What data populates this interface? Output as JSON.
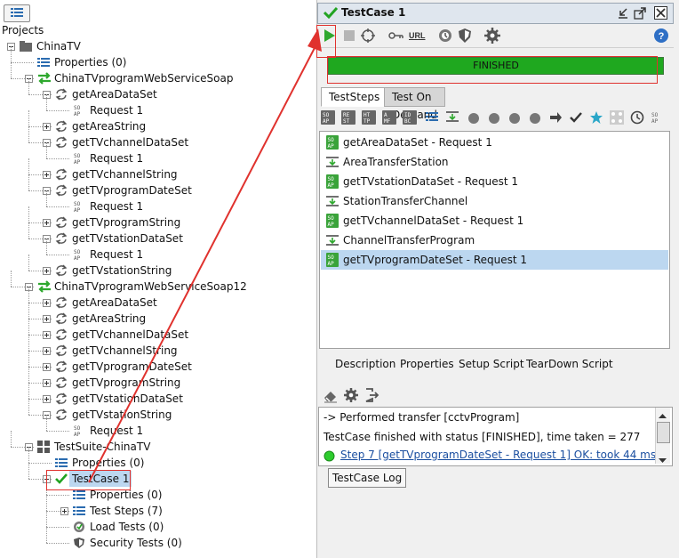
{
  "navigator": {
    "root_label": "Projects",
    "tree": [
      {
        "label": "ChinaTV",
        "icon": "folder-icon",
        "level": 0,
        "expander": "minus"
      },
      {
        "label": "Properties (0)",
        "icon": "properties-icon",
        "level": 1,
        "expander": null
      },
      {
        "label": "ChinaTVprogramWebServiceSoap",
        "icon": "interface-icon",
        "level": 1,
        "expander": "minus"
      },
      {
        "label": "getAreaDataSet",
        "icon": "operation-icon",
        "level": 2,
        "expander": "minus"
      },
      {
        "label": "Request 1",
        "icon": "soap-request-icon",
        "level": 3,
        "expander": null
      },
      {
        "label": "getAreaString",
        "icon": "operation-icon",
        "level": 2,
        "expander": "plus"
      },
      {
        "label": "getTVchannelDataSet",
        "icon": "operation-icon",
        "level": 2,
        "expander": "minus"
      },
      {
        "label": "Request 1",
        "icon": "soap-request-icon",
        "level": 3,
        "expander": null
      },
      {
        "label": "getTVchannelString",
        "icon": "operation-icon",
        "level": 2,
        "expander": "plus"
      },
      {
        "label": "getTVprogramDateSet",
        "icon": "operation-icon",
        "level": 2,
        "expander": "minus"
      },
      {
        "label": "Request 1",
        "icon": "soap-request-icon",
        "level": 3,
        "expander": null
      },
      {
        "label": "getTVprogramString",
        "icon": "operation-icon",
        "level": 2,
        "expander": "plus"
      },
      {
        "label": "getTVstationDataSet",
        "icon": "operation-icon",
        "level": 2,
        "expander": "minus"
      },
      {
        "label": "Request 1",
        "icon": "soap-request-icon",
        "level": 3,
        "expander": null
      },
      {
        "label": "getTVstationString",
        "icon": "operation-icon",
        "level": 2,
        "expander": "plus"
      },
      {
        "label": "ChinaTVprogramWebServiceSoap12",
        "icon": "interface-icon",
        "level": 1,
        "expander": "minus"
      },
      {
        "label": "getAreaDataSet",
        "icon": "operation-icon",
        "level": 2,
        "expander": "plus"
      },
      {
        "label": "getAreaString",
        "icon": "operation-icon",
        "level": 2,
        "expander": "plus"
      },
      {
        "label": "getTVchannelDataSet",
        "icon": "operation-icon",
        "level": 2,
        "expander": "plus"
      },
      {
        "label": "getTVchannelString",
        "icon": "operation-icon",
        "level": 2,
        "expander": "plus"
      },
      {
        "label": "getTVprogramDateSet",
        "icon": "operation-icon",
        "level": 2,
        "expander": "plus"
      },
      {
        "label": "getTVprogramString",
        "icon": "operation-icon",
        "level": 2,
        "expander": "plus"
      },
      {
        "label": "getTVstationDataSet",
        "icon": "operation-icon",
        "level": 2,
        "expander": "plus"
      },
      {
        "label": "getTVstationString",
        "icon": "operation-icon",
        "level": 2,
        "expander": "minus"
      },
      {
        "label": "Request 1",
        "icon": "soap-request-icon",
        "level": 3,
        "expander": null
      },
      {
        "label": "TestSuite-ChinaTV",
        "icon": "testsuite-icon",
        "level": 1,
        "expander": "minus"
      },
      {
        "label": "Properties (0)",
        "icon": "properties-icon",
        "level": 2,
        "expander": null
      },
      {
        "label": "TestCase 1",
        "icon": "check-icon",
        "level": 2,
        "expander": "minus",
        "selected": true
      },
      {
        "label": "Properties (0)",
        "icon": "properties-icon",
        "level": 3,
        "expander": null
      },
      {
        "label": "Test Steps (7)",
        "icon": "properties-icon",
        "level": 3,
        "expander": "plus"
      },
      {
        "label": "Load Tests (0)",
        "icon": "loadtest-icon",
        "level": 3,
        "expander": null
      },
      {
        "label": "Security Tests (0)",
        "icon": "shield-icon",
        "level": 3,
        "expander": null
      }
    ]
  },
  "editor": {
    "title": "TestCase 1",
    "toolbar_url": "URL",
    "progress": {
      "status": "FINISHED",
      "fraction": 1.0
    },
    "tabs": [
      "TestSteps",
      "Test On Demand"
    ],
    "step_tool_labels": [
      "SO AP",
      "RE ST",
      "HT TP",
      "A MF",
      "ID BC"
    ],
    "steps": [
      {
        "label": "getAreaDataSet - Request 1",
        "icon": "soap-icon"
      },
      {
        "label": "AreaTransferStation",
        "icon": "transfer-icon"
      },
      {
        "label": "getTVstationDataSet - Request 1",
        "icon": "soap-icon"
      },
      {
        "label": "StationTransferChannel",
        "icon": "transfer-icon"
      },
      {
        "label": "getTVchannelDataSet - Request 1",
        "icon": "soap-icon"
      },
      {
        "label": "ChannelTransferProgram",
        "icon": "transfer-icon"
      },
      {
        "label": "getTVprogramDateSet - Request 1",
        "icon": "soap-icon",
        "selected": true
      }
    ],
    "subtabs": [
      "Description",
      "Properties",
      "Setup Script",
      "TearDown Script"
    ],
    "log": [
      "-> Performed transfer [cctvProgram]",
      "TestCase finished with status [FINISHED], time taken = 277",
      "Step 7 [getTVprogramDateSet - Request 1] OK: took 44 ms"
    ],
    "log_button": "TestCase Log"
  },
  "colors": {
    "accent_green": "#1fa81f",
    "selection": "#bcd7f0",
    "annotation_red": "#e0322e"
  }
}
